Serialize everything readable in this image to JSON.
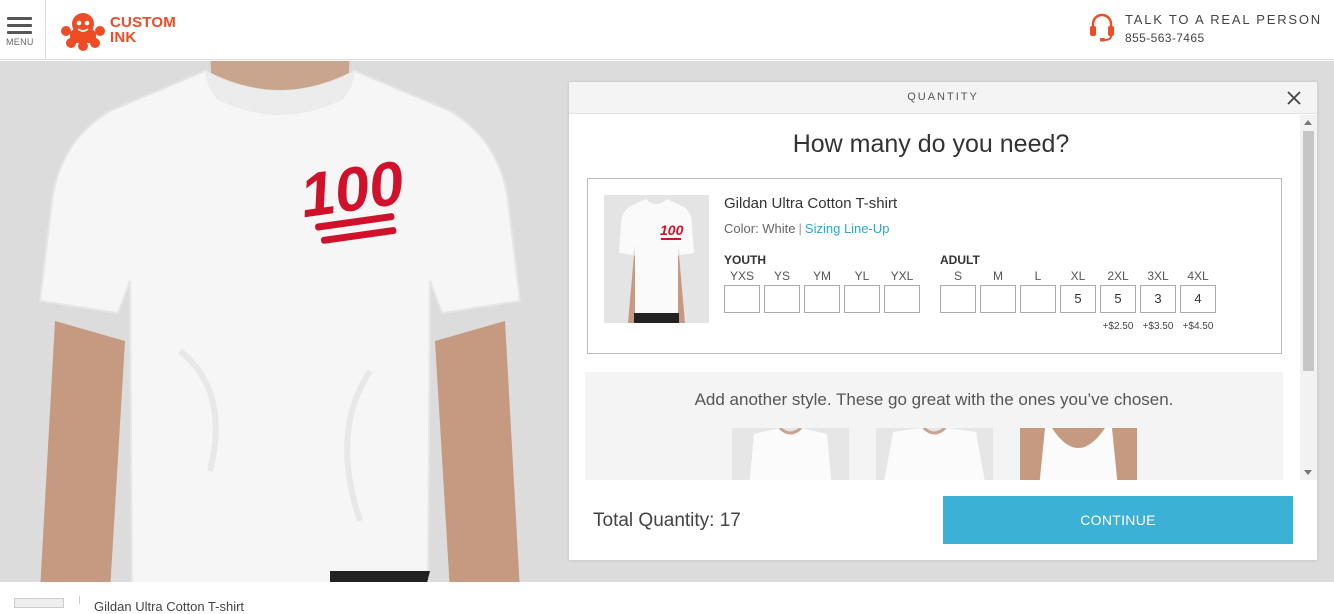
{
  "header": {
    "menu_label": "MENU",
    "logo_line1": "CUSTOM",
    "logo_line2": "INK",
    "contact_title": "TALK TO A REAL PERSON",
    "contact_phone": "855-563-7465"
  },
  "design": {
    "badge_text": "100"
  },
  "modal": {
    "title": "QUANTITY",
    "heading": "How many do you need?",
    "product": {
      "name": "Gildan Ultra Cotton T-shirt",
      "color_label": "Color: White",
      "separator": "|",
      "sizing_link": "Sizing Line-Up",
      "badge_text": "100"
    },
    "youth": {
      "label": "YOUTH",
      "sizes": [
        {
          "size": "YXS",
          "qty": ""
        },
        {
          "size": "YS",
          "qty": ""
        },
        {
          "size": "YM",
          "qty": ""
        },
        {
          "size": "YL",
          "qty": ""
        },
        {
          "size": "YXL",
          "qty": ""
        }
      ]
    },
    "adult": {
      "label": "ADULT",
      "sizes": [
        {
          "size": "S",
          "qty": "",
          "upcharge": ""
        },
        {
          "size": "M",
          "qty": "",
          "upcharge": ""
        },
        {
          "size": "L",
          "qty": "",
          "upcharge": ""
        },
        {
          "size": "XL",
          "qty": "5",
          "upcharge": ""
        },
        {
          "size": "2XL",
          "qty": "5",
          "upcharge": "+$2.50"
        },
        {
          "size": "3XL",
          "qty": "3",
          "upcharge": "+$3.50"
        },
        {
          "size": "4XL",
          "qty": "4",
          "upcharge": "+$4.50"
        }
      ]
    },
    "suggest_text": "Add another style. These go great with the ones you’ve chosen.",
    "total_label": "Total Quantity: 17",
    "continue_label": "CONTINUE"
  },
  "footer": {
    "product_title": "Gildan Ultra Cotton T-shirt"
  },
  "colors": {
    "brand": "#ef4b24",
    "accent": "#3bb1d5",
    "badge": "#d0112b"
  }
}
